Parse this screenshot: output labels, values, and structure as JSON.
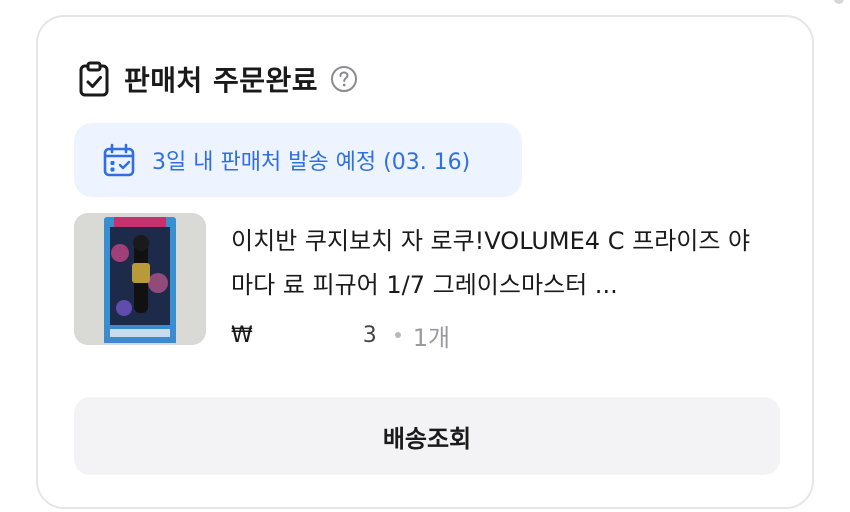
{
  "order": {
    "title": "판매처 주문완료",
    "icons": {
      "status": "clipboard-check-icon",
      "help": "question-circle-icon",
      "schedule": "calendar-icon"
    },
    "notice": "3일 내 판매처 발송 예정 (03. 16)"
  },
  "product": {
    "name": "이치반 쿠지보치 자 로쿠!VOLUME4 C 프라이즈 야마다 료 피규어 1/7 그레이스마스터 ...",
    "price_prefix": "₩",
    "price_suffix": "3",
    "quantity": "1개"
  },
  "actions": {
    "track_label": "배송조회"
  },
  "colors": {
    "accent": "#2f6fe4",
    "notice_bg": "#eef4ff",
    "button_bg": "#f3f3f5",
    "border": "#e6e6e9"
  }
}
